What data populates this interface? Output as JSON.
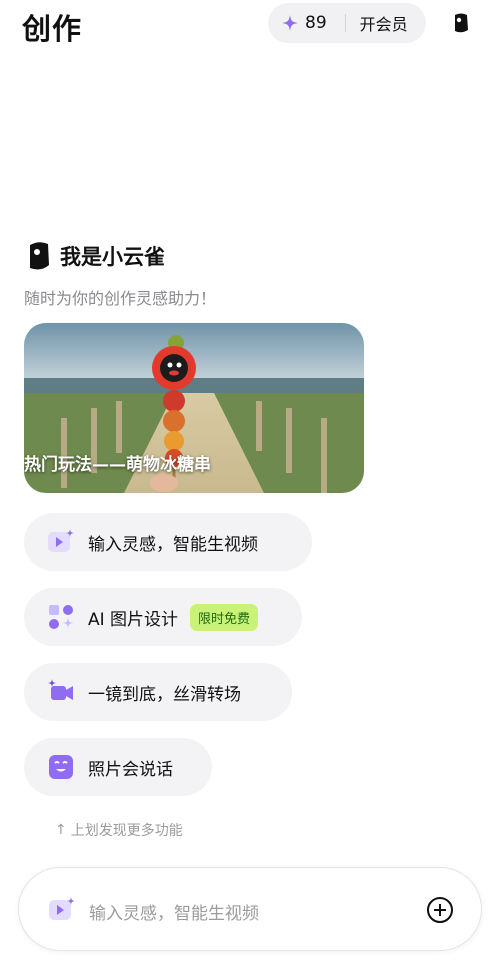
{
  "header": {
    "title": "创作",
    "credits": "89",
    "vip_label": "开会员",
    "star_icon": "sparkle-icon",
    "mascot_icon": "lark-mascot-icon"
  },
  "intro": {
    "name": "我是小云雀",
    "tagline": "随时为你的创作灵感助力！"
  },
  "banner": {
    "caption": "热门玩法——萌物冰糖串"
  },
  "features": [
    {
      "label": "输入灵感，智能生视频",
      "icon": "video-spark-icon"
    },
    {
      "label": "AI 图片设计",
      "icon": "image-design-icon",
      "badge": "限时免费"
    },
    {
      "label": "一镜到底，丝滑转场",
      "icon": "camera-spark-icon"
    },
    {
      "label": "照片会说话",
      "icon": "talking-face-icon"
    }
  ],
  "swipe_hint": "上划发现更多功能",
  "input": {
    "placeholder": "输入灵感，智能生视频",
    "add_icon": "plus-circle-icon"
  },
  "colors": {
    "accent": "#8f6cf2",
    "accent_soft": "#e3dcff",
    "badge_bg": "#c9f276",
    "badge_text": "#1d6b0f"
  }
}
